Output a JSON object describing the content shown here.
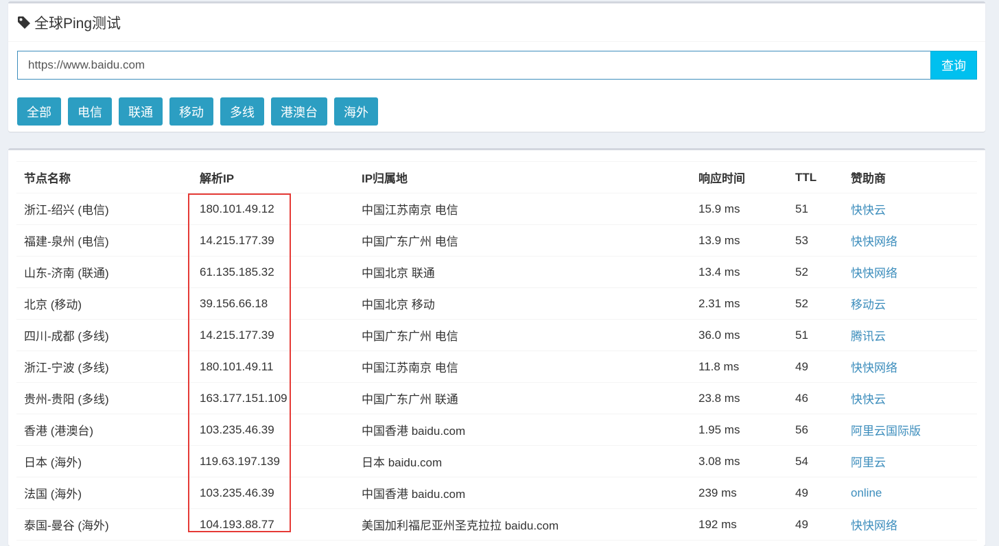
{
  "header": {
    "title": "全球Ping测试",
    "icon": "tag-icon"
  },
  "search": {
    "value": "https://www.baidu.com",
    "button_label": "查询"
  },
  "filters": [
    "全部",
    "电信",
    "联通",
    "移动",
    "多线",
    "港澳台",
    "海外"
  ],
  "colors": {
    "accent": "#00c0ef",
    "filter_button": "#2c9ec2",
    "link": "#3c8dbc",
    "highlight": "#e53935"
  },
  "table": {
    "columns": [
      "节点名称",
      "解析IP",
      "IP归属地",
      "响应时间",
      "TTL",
      "赞助商"
    ],
    "rows": [
      {
        "node": "浙江-绍兴 (电信)",
        "ip": "180.101.49.12",
        "location": "中国江苏南京 电信",
        "time": "15.9 ms",
        "ttl": "51",
        "sponsor": "快快云"
      },
      {
        "node": "福建-泉州 (电信)",
        "ip": "14.215.177.39",
        "location": "中国广东广州 电信",
        "time": "13.9 ms",
        "ttl": "53",
        "sponsor": "快快网络"
      },
      {
        "node": "山东-济南 (联通)",
        "ip": "61.135.185.32",
        "location": "中国北京 联通",
        "time": "13.4 ms",
        "ttl": "52",
        "sponsor": "快快网络"
      },
      {
        "node": "北京 (移动)",
        "ip": "39.156.66.18",
        "location": "中国北京 移动",
        "time": "2.31 ms",
        "ttl": "52",
        "sponsor": "移动云"
      },
      {
        "node": "四川-成都 (多线)",
        "ip": "14.215.177.39",
        "location": "中国广东广州 电信",
        "time": "36.0 ms",
        "ttl": "51",
        "sponsor": "腾讯云"
      },
      {
        "node": "浙江-宁波 (多线)",
        "ip": "180.101.49.11",
        "location": "中国江苏南京 电信",
        "time": "11.8 ms",
        "ttl": "49",
        "sponsor": "快快网络"
      },
      {
        "node": "贵州-贵阳 (多线)",
        "ip": "163.177.151.109",
        "location": "中国广东广州 联通",
        "time": "23.8 ms",
        "ttl": "46",
        "sponsor": "快快云"
      },
      {
        "node": "香港 (港澳台)",
        "ip": "103.235.46.39",
        "location": "中国香港 baidu.com",
        "time": "1.95 ms",
        "ttl": "56",
        "sponsor": "阿里云国际版"
      },
      {
        "node": "日本 (海外)",
        "ip": "119.63.197.139",
        "location": "日本 baidu.com",
        "time": "3.08 ms",
        "ttl": "54",
        "sponsor": "阿里云"
      },
      {
        "node": "法国 (海外)",
        "ip": "103.235.46.39",
        "location": "中国香港 baidu.com",
        "time": "239 ms",
        "ttl": "49",
        "sponsor": "online"
      },
      {
        "node": "泰国-曼谷 (海外)",
        "ip": "104.193.88.77",
        "location": "美国加利福尼亚州圣克拉拉 baidu.com",
        "time": "192 ms",
        "ttl": "49",
        "sponsor": "快快网络"
      }
    ]
  }
}
